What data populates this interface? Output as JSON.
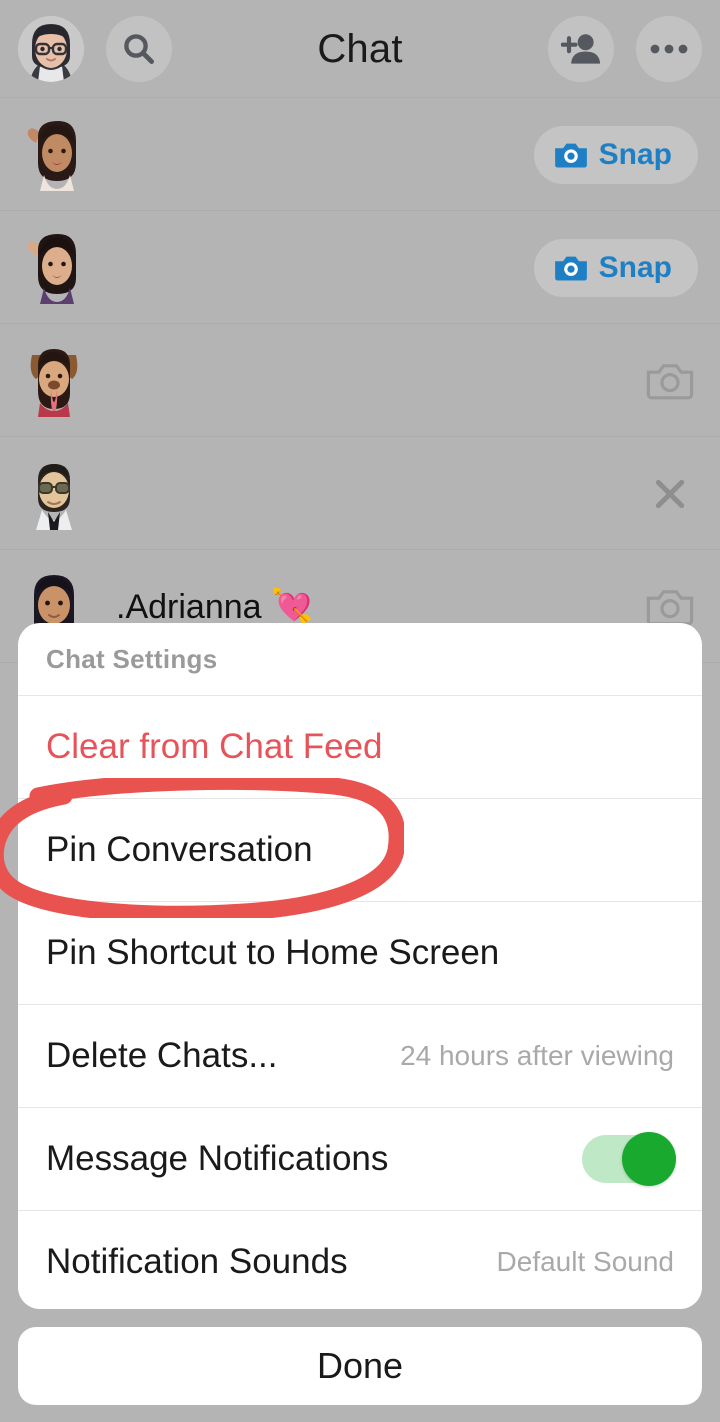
{
  "header": {
    "title": "Chat",
    "avatar_icon": "bitmoji-avatar",
    "search_icon": "search-icon",
    "add_friend_icon": "add-friend-icon",
    "more_icon": "more-options-icon"
  },
  "chat_list": {
    "rows": [
      {
        "name": "",
        "avatar_icon": "bitmoji-waving-avatar",
        "action": "snap",
        "action_label": "Snap"
      },
      {
        "name": "",
        "avatar_icon": "bitmoji-waving-avatar",
        "action": "snap",
        "action_label": "Snap"
      },
      {
        "name": "",
        "avatar_icon": "bitmoji-dog-filter-avatar",
        "action": "camera",
        "action_label": ""
      },
      {
        "name": "",
        "avatar_icon": "bitmoji-sunglasses-avatar",
        "action": "close",
        "action_label": ""
      },
      {
        "name": ".Adrianna 💘",
        "avatar_icon": "bitmoji-avatar",
        "action": "camera",
        "action_label": ""
      }
    ]
  },
  "bottom_nav": {
    "items": [
      {
        "icon": "map-icon",
        "badge": ""
      },
      {
        "icon": "chat-icon",
        "badge": "unread"
      },
      {
        "icon": "camera-icon",
        "badge": ""
      },
      {
        "icon": "stories-icon",
        "badge": ""
      },
      {
        "icon": "spotlight-icon",
        "badge": ""
      }
    ]
  },
  "sheet": {
    "title": "Chat Settings",
    "items": [
      {
        "label": "Clear from Chat Feed",
        "value": "",
        "style": "destructive",
        "control": "none"
      },
      {
        "label": "Pin Conversation",
        "value": "",
        "style": "default",
        "control": "none"
      },
      {
        "label": "Pin Shortcut to Home Screen",
        "value": "",
        "style": "default",
        "control": "none"
      },
      {
        "label": "Delete Chats...",
        "value": "24 hours after viewing",
        "style": "default",
        "control": "none"
      },
      {
        "label": "Message Notifications",
        "value": "",
        "style": "default",
        "control": "toggle",
        "toggle_on": true
      },
      {
        "label": "Notification Sounds",
        "value": "Default Sound",
        "style": "default",
        "control": "none"
      }
    ]
  },
  "done_button": {
    "label": "Done"
  },
  "annotation": {
    "shape": "ellipse",
    "target": "Pin Conversation",
    "color": "#e8524f"
  },
  "colors": {
    "background_dim": "#b4b4b4",
    "sheet": "#ffffff",
    "destructive": "#e7535a",
    "snap_blue": "#1f7fc4",
    "toggle_on": "#18a92e",
    "annotation_red": "#e8524f",
    "badge_red": "#cc2233"
  }
}
